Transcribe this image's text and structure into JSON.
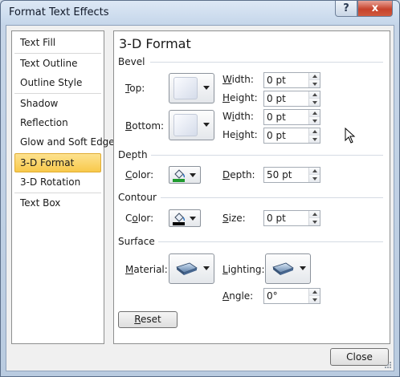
{
  "window": {
    "title": "Format Text Effects"
  },
  "titlebar": {
    "help_label": "?",
    "close_label": "x"
  },
  "nav": {
    "items": [
      {
        "label": "Text Fill"
      },
      {
        "label": "Text Outline"
      },
      {
        "label": "Outline Style"
      },
      {
        "label": "Shadow"
      },
      {
        "label": "Reflection"
      },
      {
        "label": "Glow and Soft Edges"
      },
      {
        "label": "3-D Format"
      },
      {
        "label": "3-D Rotation"
      },
      {
        "label": "Text Box"
      }
    ],
    "selected": "3-D Format"
  },
  "panel": {
    "title": "3-D Format",
    "bevel": {
      "heading": "Bevel",
      "top_label_pre": "",
      "top_label_ul": "T",
      "top_label_post": "op:",
      "bottom_label_pre": "",
      "bottom_label_ul": "B",
      "bottom_label_post": "ottom:",
      "top_width_label_ul": "W",
      "top_width_label_post": "idth:",
      "top_width_value": "0 pt",
      "top_height_label_ul": "H",
      "top_height_label_post": "eight:",
      "top_height_value": "0 pt",
      "bottom_width_label_pre": "W",
      "bottom_width_label_ul": "i",
      "bottom_width_label_post": "dth:",
      "bottom_width_value": "0 pt",
      "bottom_height_label_pre": "He",
      "bottom_height_label_ul": "i",
      "bottom_height_label_post": "ght:",
      "bottom_height_value": "0 pt"
    },
    "depth": {
      "heading": "Depth",
      "color_label_pre": "",
      "color_label_ul": "C",
      "color_label_post": "olor:",
      "depth_label_pre": "",
      "depth_label_ul": "D",
      "depth_label_post": "epth:",
      "depth_value": "50 pt",
      "color_swatch": "#1f9a2e"
    },
    "contour": {
      "heading": "Contour",
      "color_label_pre": "C",
      "color_label_ul": "o",
      "color_label_post": "lor:",
      "size_label_pre": "",
      "size_label_ul": "S",
      "size_label_post": "ize:",
      "size_value": "0 pt",
      "color_swatch": "#000000"
    },
    "surface": {
      "heading": "Surface",
      "material_label_pre": "",
      "material_label_ul": "M",
      "material_label_post": "aterial:",
      "lighting_label_pre": "",
      "lighting_label_ul": "L",
      "lighting_label_post": "ighting:",
      "angle_label_pre": "",
      "angle_label_ul": "A",
      "angle_label_post": "ngle:",
      "angle_value": "0°"
    },
    "reset_pre": "",
    "reset_ul": "R",
    "reset_post": "eset"
  },
  "footer": {
    "close_label": "Close"
  },
  "colors": {
    "selection_fill": "#f8c94b",
    "accent_border": "#e0ac33"
  }
}
